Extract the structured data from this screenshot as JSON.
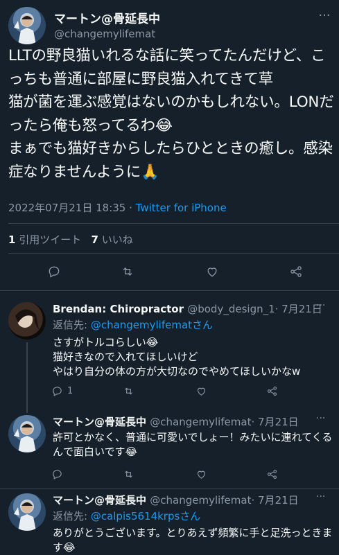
{
  "main": {
    "name": "マートン@骨延長中",
    "handle": "@changemylifemat",
    "text": "LLTの野良猫いれるな話に笑ってたんだけど、こっちも普通に部屋に野良猫入れてきて草\n猫が菌を運ぶ感覚はないのかもしれない。LONだったら俺も怒ってるわ😂\nまぁでも猫好きからしたらひとときの癒し。感染症なりませんように🙏",
    "date": "2022年07月21日 18:35",
    "separator": " · ",
    "source": "Twitter for iPhone",
    "quote_count": "1",
    "quote_label": "引用ツイート",
    "like_count": "7",
    "like_label": "いいね",
    "more": "···"
  },
  "replies": [
    {
      "name": "Brendan: Chiropractor",
      "handle": "@body_design_1",
      "date": "· 7月21日",
      "replying_label": "返信先: ",
      "replying_to": "@changemylifematさん",
      "text": "さすがトルコらしい😂\n猫好きなので入れてほしいけど\nやはり自分の体の方が大切なのでやめてほしいかなw",
      "reply_count": "1",
      "more": "···"
    },
    {
      "name": "マートン@骨延長中",
      "handle": "@changemylifemat",
      "date": "· 7月21日",
      "text": "許可とかなく、普通に可愛いでしょー！みたいに連れてくるんで面白いです😂",
      "more": "···"
    },
    {
      "name": "マートン@骨延長中",
      "handle": "@changemylifemat",
      "date": "· 7月21日",
      "replying_label": "返信先: ",
      "replying_to": "@calpis5614krpsさん",
      "text": "ありがとうございます。とりあえず頻繁に手と足洗っときます😂",
      "more": "···"
    }
  ],
  "icons": [
    "reply-icon",
    "retweet-icon",
    "like-icon",
    "share-icon"
  ],
  "colors": {
    "background": "#15202b",
    "text": "#f7f9f9",
    "muted": "#8b98a5",
    "link": "#1d9bf0",
    "divider": "#38444d"
  }
}
